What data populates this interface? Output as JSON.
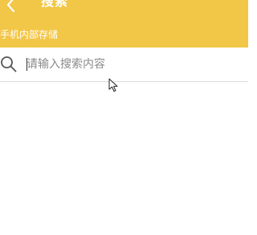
{
  "header": {
    "title": "搜索",
    "subtitle": "手机内部存储",
    "back_icon": "back-chevron-icon",
    "background_color": "#f2c646"
  },
  "search": {
    "icon": "search-icon",
    "placeholder": "请输入搜索内容",
    "value": ""
  }
}
